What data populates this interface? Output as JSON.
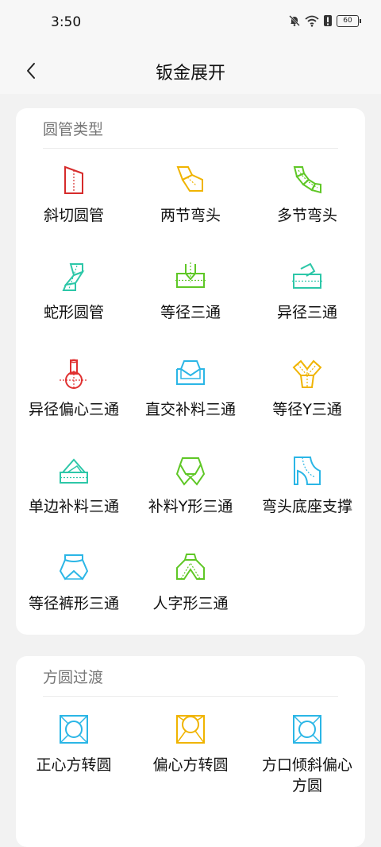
{
  "status": {
    "time": "3:50",
    "battery": "60"
  },
  "header": {
    "title": "钣金展开"
  },
  "sections": [
    {
      "title": "圆管类型",
      "items": [
        {
          "label": "斜切圆管",
          "icon": "bevel-cut-pipe-icon",
          "color": "#d62b2b"
        },
        {
          "label": "两节弯头",
          "icon": "two-section-elbow-icon",
          "color": "#f0b400"
        },
        {
          "label": "多节弯头",
          "icon": "multi-section-elbow-icon",
          "color": "#5fc726"
        },
        {
          "label": "蛇形圆管",
          "icon": "snake-pipe-icon",
          "color": "#2dc7a8"
        },
        {
          "label": "等径三通",
          "icon": "equal-tee-icon",
          "color": "#5fc726"
        },
        {
          "label": "异径三通",
          "icon": "reducing-tee-icon",
          "color": "#2dc7a8"
        },
        {
          "label": "异径偏心三通",
          "icon": "eccentric-reducing-tee-icon",
          "color": "#e03131"
        },
        {
          "label": "直交补料三通",
          "icon": "orthogonal-patch-tee-icon",
          "color": "#2bb6e6"
        },
        {
          "label": "等径Y三通",
          "icon": "equal-y-tee-icon",
          "color": "#f0b400"
        },
        {
          "label": "单边补料三通",
          "icon": "single-side-patch-tee-icon",
          "color": "#2dc7a8"
        },
        {
          "label": "补料Y形三通",
          "icon": "patch-y-tee-icon",
          "color": "#5fc726"
        },
        {
          "label": "弯头底座支撑",
          "icon": "elbow-base-support-icon",
          "color": "#2bb6e6"
        },
        {
          "label": "等径裤形三通",
          "icon": "equal-pants-tee-icon",
          "color": "#2bb6e6"
        },
        {
          "label": "人字形三通",
          "icon": "herringbone-tee-icon",
          "color": "#5fc726"
        }
      ]
    },
    {
      "title": "方圆过渡",
      "items": [
        {
          "label": "正心方转圆",
          "icon": "centered-square-to-round-icon",
          "color": "#2bb6e6"
        },
        {
          "label": "偏心方转圆",
          "icon": "eccentric-square-to-round-icon",
          "color": "#f0b400"
        },
        {
          "label": "方口倾斜偏心方圆",
          "icon": "inclined-eccentric-square-round-icon",
          "color": "#2bb6e6"
        }
      ]
    }
  ]
}
